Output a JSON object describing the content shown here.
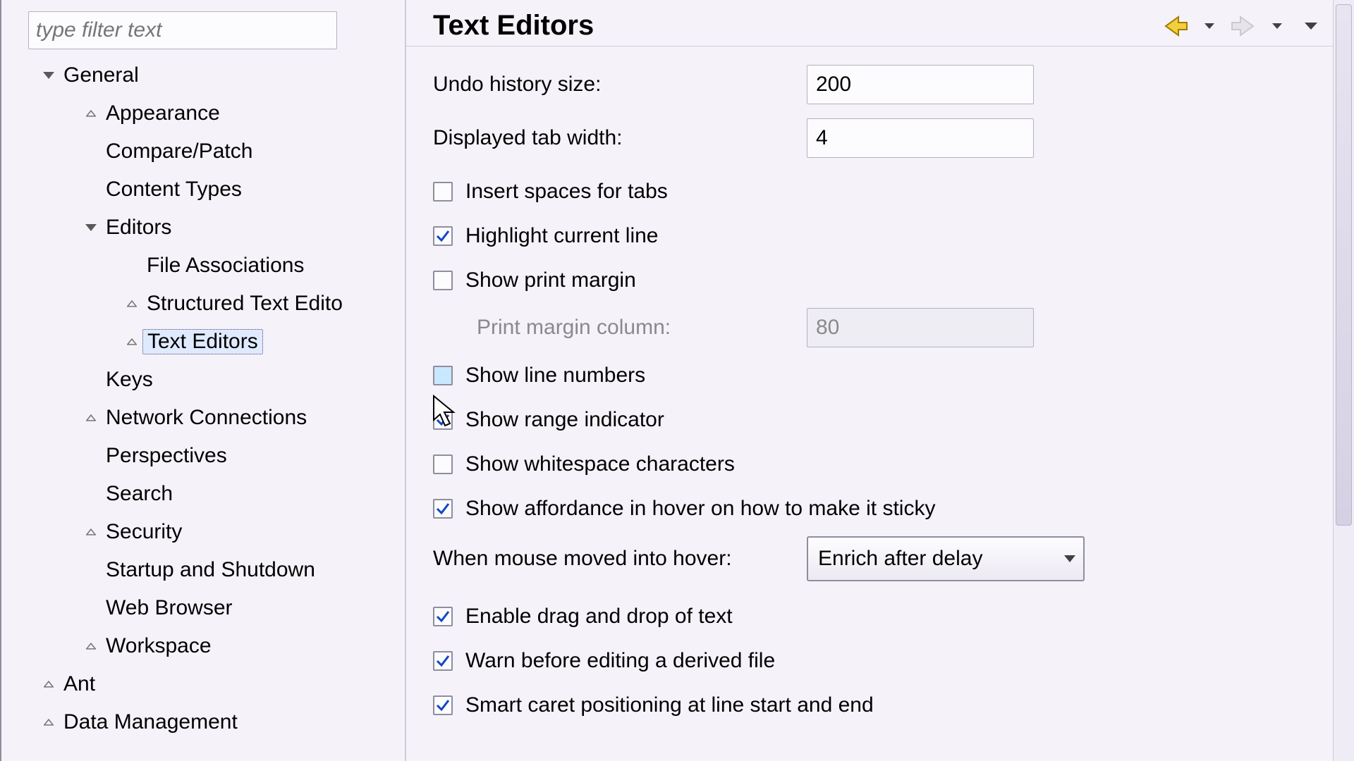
{
  "sidebar": {
    "filter_placeholder": "type filter text",
    "tree": {
      "general": "General",
      "appearance": "Appearance",
      "compare_patch": "Compare/Patch",
      "content_types": "Content Types",
      "editors": "Editors",
      "file_associations": "File Associations",
      "structured_text_editors": "Structured Text Edito",
      "text_editors": "Text Editors",
      "keys": "Keys",
      "network_connections": "Network Connections",
      "perspectives": "Perspectives",
      "search": "Search",
      "security": "Security",
      "startup_shutdown": "Startup and Shutdown",
      "web_browser": "Web Browser",
      "workspace": "Workspace",
      "ant": "Ant",
      "data_management": "Data Management"
    }
  },
  "page": {
    "title": "Text Editors",
    "undo_history_label": "Undo history size:",
    "undo_history_value": "200",
    "tab_width_label": "Displayed tab width:",
    "tab_width_value": "4",
    "insert_spaces_label": "Insert spaces for tabs",
    "insert_spaces_checked": false,
    "highlight_line_label": "Highlight current line",
    "highlight_line_checked": true,
    "show_print_margin_label": "Show print margin",
    "show_print_margin_checked": false,
    "print_margin_column_label": "Print margin column:",
    "print_margin_column_value": "80",
    "show_line_numbers_label": "Show line numbers",
    "show_line_numbers_checked": false,
    "show_range_indicator_label": "Show range indicator",
    "show_range_indicator_checked": true,
    "show_whitespace_label": "Show whitespace characters",
    "show_whitespace_checked": false,
    "affordance_hover_label": "Show affordance in hover on how to make it sticky",
    "affordance_hover_checked": true,
    "hover_mode_label": "When mouse moved into hover:",
    "hover_mode_selected": "Enrich after delay",
    "enable_dnd_label": "Enable drag and drop of text",
    "enable_dnd_checked": true,
    "warn_derived_label": "Warn before editing a derived file",
    "warn_derived_checked": true,
    "smart_caret_label": "Smart caret positioning at line start and end",
    "smart_caret_checked": true
  }
}
